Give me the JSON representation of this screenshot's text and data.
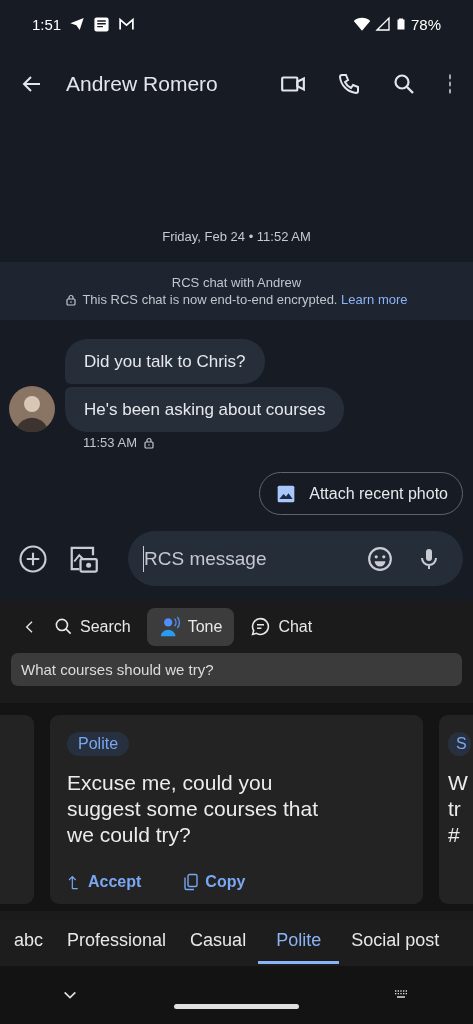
{
  "status_bar": {
    "time": "1:51",
    "battery": "78%"
  },
  "header": {
    "title": "Andrew Romero"
  },
  "thread": {
    "date": "Friday, Feb 24 • 11:52 AM",
    "banner_title": "RCS chat with Andrew",
    "banner_text": "This RCS chat is now end-to-end encrypted.",
    "banner_link": "Learn more",
    "messages": [
      {
        "text": "Did you talk to Chris?"
      },
      {
        "text": "He's been asking about courses"
      }
    ],
    "time": "11:53 AM"
  },
  "suggestion": {
    "label": "Attach recent photo"
  },
  "compose": {
    "placeholder": "RCS message"
  },
  "keyboard": {
    "tabs": [
      {
        "kind": "search",
        "label": "Search",
        "selected": false
      },
      {
        "kind": "tone",
        "label": "Tone",
        "selected": true
      },
      {
        "kind": "chat",
        "label": "Chat",
        "selected": false
      }
    ],
    "query": "What courses should we try?",
    "card": {
      "tag": "Polite",
      "text": "Excuse me, could you suggest some courses that we could try?",
      "actions": [
        {
          "kind": "accept",
          "label": "Accept"
        },
        {
          "kind": "copy",
          "label": "Copy"
        }
      ]
    },
    "next_card": {
      "tag": "S",
      "lines": [
        "W",
        "tr",
        "#"
      ]
    },
    "tones": [
      {
        "label": "abc",
        "selected": false
      },
      {
        "label": "Professional",
        "selected": false
      },
      {
        "label": "Casual",
        "selected": false
      },
      {
        "label": "Polite",
        "selected": true
      },
      {
        "label": "Social post",
        "selected": false
      }
    ]
  }
}
